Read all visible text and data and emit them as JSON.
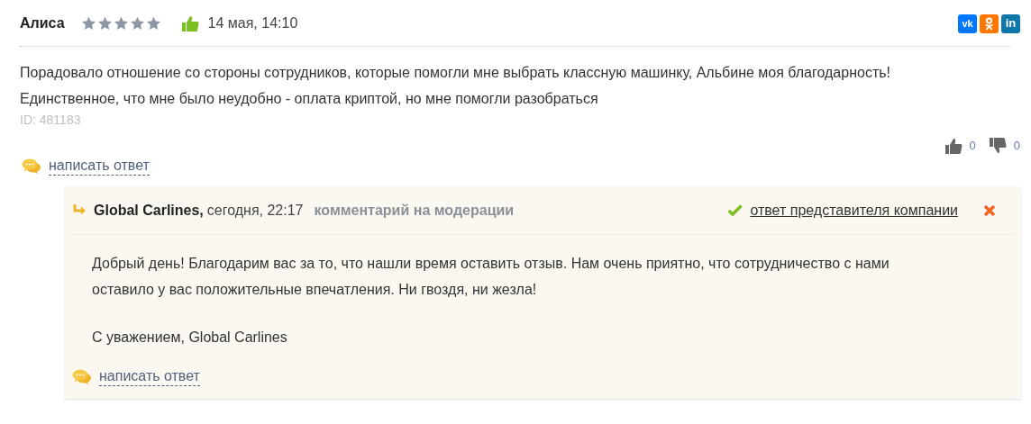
{
  "review": {
    "author": "Алиса",
    "stars": 5,
    "liked": true,
    "date": "14 мая, 14:10",
    "share": [
      {
        "kind": "vk",
        "label": "vk"
      },
      {
        "kind": "ok"
      },
      {
        "kind": "linkedin",
        "label": "in"
      }
    ],
    "text": [
      "Порадовало отношение со стороны сотрудников, которые помогли мне выбрать классную машинку, Альбине моя благодарность!",
      "Единственное, что мне было неудобно - оплата криптой, но мне помогли разобраться"
    ],
    "id": "ID: 481183",
    "votes": [
      {
        "kind": "up",
        "count": "0"
      },
      {
        "kind": "down",
        "count": "0"
      }
    ],
    "reply_link": "написать ответ"
  },
  "answer": {
    "author": "Global Carlines,",
    "date": "сегодня, 22:17",
    "status": "комментарий на модерации",
    "official": true,
    "official_label": "ответ представителя компании",
    "paragraphs": [
      "Добрый день! Благодарим вас за то, что нашли время оставить отзыв. Нам очень приятно, что сотрудничество с нами оставило у вас положительные впечатления. Ни гвоздя, ни жезла!",
      "С уважением, Global Carlines"
    ],
    "reply_link": "написать ответ"
  }
}
